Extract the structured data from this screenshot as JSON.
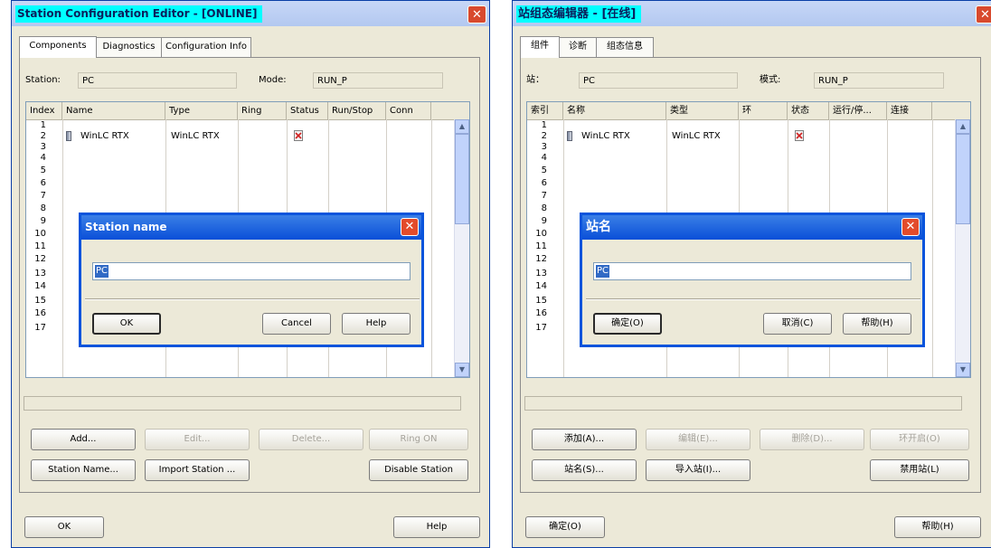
{
  "left": {
    "title": "Station Configuration Editor - [ONLINE]",
    "tabs": [
      "Components",
      "Diagnostics",
      "Configuration Info"
    ],
    "station_label": "Station:",
    "station_value": "PC",
    "mode_label": "Mode:",
    "mode_value": "RUN_P",
    "columns": [
      "Index",
      "Name",
      "Type",
      "Ring",
      "Status",
      "Run/Stop",
      "Conn"
    ],
    "rows": [
      "1",
      "2",
      "3",
      "4",
      "5",
      "6",
      "7",
      "8",
      "9",
      "10",
      "11",
      "12",
      "13",
      "14",
      "15",
      "16",
      "17"
    ],
    "row2_name": "WinLC RTX",
    "row2_type": "WinLC RTX",
    "buttons": {
      "add": "Add...",
      "edit": "Edit...",
      "delete": "Delete...",
      "ring_on": "Ring ON",
      "station_name": "Station Name...",
      "import_station": "Import Station ...",
      "disable_station": "Disable Station",
      "ok": "OK",
      "help": "Help"
    },
    "dialog": {
      "title": "Station name",
      "input_value": "PC",
      "ok": "OK",
      "cancel": "Cancel",
      "help": "Help"
    }
  },
  "right": {
    "title": "站组态编辑器 - [在线]",
    "tabs": [
      "组件",
      "诊断",
      "组态信息"
    ],
    "station_label": "站：",
    "station_value": "PC",
    "mode_label": "模式:",
    "mode_value": "RUN_P",
    "columns": [
      "索引",
      "名称",
      "类型",
      "环",
      "状态",
      "运行/停...",
      "连接"
    ],
    "rows": [
      "1",
      "2",
      "3",
      "4",
      "5",
      "6",
      "7",
      "8",
      "9",
      "10",
      "11",
      "12",
      "13",
      "14",
      "15",
      "16",
      "17"
    ],
    "row2_name": "WinLC RTX",
    "row2_type": "WinLC RTX",
    "buttons": {
      "add": "添加(A)...",
      "edit": "编辑(E)...",
      "delete": "删除(D)...",
      "ring_on": "环开启(O)",
      "station_name": "站名(S)...",
      "import_station": "导入站(I)...",
      "disable_station": "禁用站(L)",
      "ok": "确定(O)",
      "help": "帮助(H)"
    },
    "dialog": {
      "title": "站名",
      "input_value": "PC",
      "ok": "确定(O)",
      "cancel": "取消(C)",
      "help": "帮助(H)"
    }
  },
  "colors": {
    "title_highlight": "#00ffff",
    "selection": "#316ac5",
    "dialog_border": "#0954dc"
  },
  "icons": [
    "close-icon",
    "plc-module-icon",
    "status-icon",
    "scroll-up-icon",
    "scroll-down-icon"
  ]
}
